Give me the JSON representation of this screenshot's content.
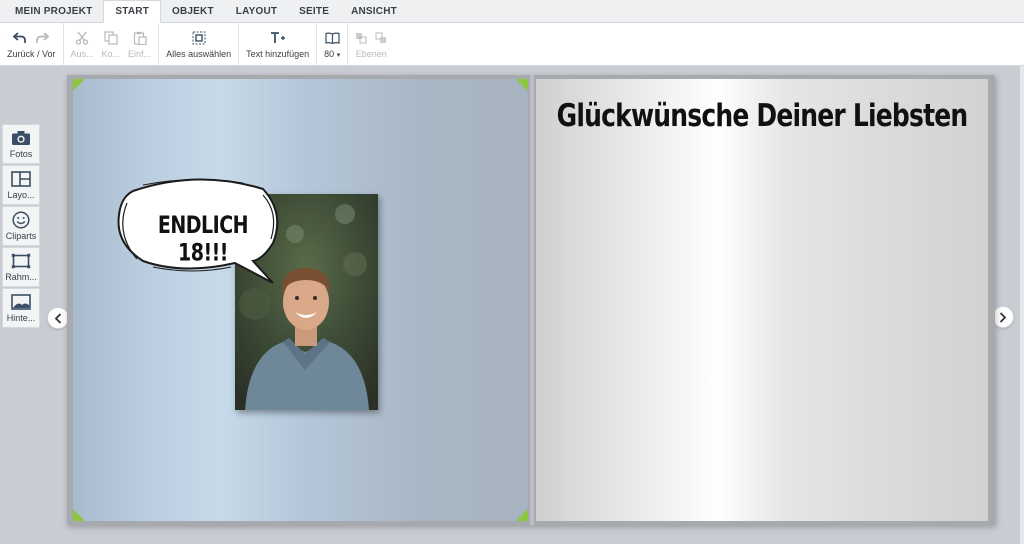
{
  "menu": {
    "tabs": [
      {
        "label": "MEIN PROJEKT",
        "active": false
      },
      {
        "label": "START",
        "active": true
      },
      {
        "label": "OBJEKT",
        "active": false
      },
      {
        "label": "LAYOUT",
        "active": false
      },
      {
        "label": "SEITE",
        "active": false
      },
      {
        "label": "ANSICHT",
        "active": false
      }
    ]
  },
  "toolbar": {
    "undo_redo_label": "Zurück / Vor",
    "cut_label": "Aus...",
    "copy_label": "Ko...",
    "paste_label": "Einf...",
    "select_all_label": "Alles auswählen",
    "add_text_label": "Text hinzufügen",
    "zoom_value": "80",
    "layers_label": "Ebenen"
  },
  "sidepanel": {
    "items": [
      {
        "label": "Fotos",
        "icon": "camera-icon"
      },
      {
        "label": "Layo...",
        "icon": "layout-icon"
      },
      {
        "label": "Cliparts",
        "icon": "smiley-icon"
      },
      {
        "label": "Rahm...",
        "icon": "frame-icon"
      },
      {
        "label": "Hinte...",
        "icon": "background-image-icon"
      }
    ]
  },
  "canvas": {
    "left_page": {
      "bubble_text": "ENDLICH 18!!!"
    },
    "right_page": {
      "headline": "Glückwünsche Deiner Liebsten"
    }
  },
  "colors": {
    "accent_corner": "#8dc63f",
    "left_page_blue": "#b9cde0",
    "right_page_silver": "#e6e6e6"
  }
}
